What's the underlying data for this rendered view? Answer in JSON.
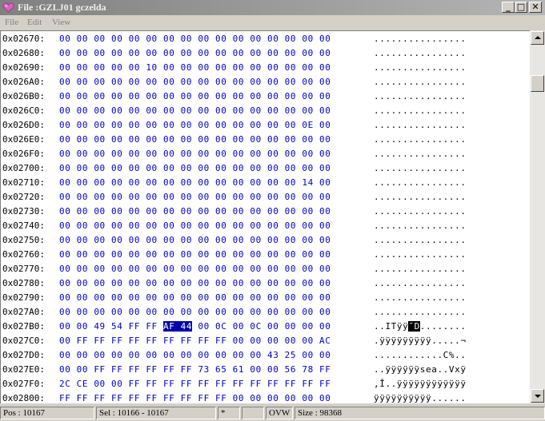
{
  "window": {
    "title": "File :GZLJ01 gczelda",
    "buttons": {
      "minimize": "_",
      "maximize": "□",
      "close": "✕"
    }
  },
  "menu": [
    {
      "label": "File",
      "accel": "F"
    },
    {
      "label": "Edit",
      "accel": "E"
    },
    {
      "label": "View",
      "accel": "V"
    }
  ],
  "rows": [
    {
      "addr": "0x02670:",
      "bytes": "00 00 00 00 00 00 00 00 00 00 00 00 00 00 00 00",
      "ascii": "................"
    },
    {
      "addr": "0x02680:",
      "bytes": "00 00 00 00 00 00 00 00 00 00 00 00 00 00 00 00",
      "ascii": "................"
    },
    {
      "addr": "0x02690:",
      "bytes": "00 00 00 00 00 10 00 00 00 00 00 00 00 00 00 00",
      "ascii": "................"
    },
    {
      "addr": "0x026A0:",
      "bytes": "00 00 00 00 00 00 00 00 00 00 00 00 00 00 00 00",
      "ascii": "................"
    },
    {
      "addr": "0x026B0:",
      "bytes": "00 00 00 00 00 00 00 00 00 00 00 00 00 00 00 00",
      "ascii": "................"
    },
    {
      "addr": "0x026C0:",
      "bytes": "00 00 00 00 00 00 00 00 00 00 00 00 00 00 00 00",
      "ascii": "................"
    },
    {
      "addr": "0x026D0:",
      "bytes": "00 00 00 00 00 00 00 00 00 00 00 00 00 00 0E 00",
      "ascii": "................"
    },
    {
      "addr": "0x026E0:",
      "bytes": "00 00 00 00 00 00 00 00 00 00 00 00 00 00 00 00",
      "ascii": "................"
    },
    {
      "addr": "0x026F0:",
      "bytes": "00 00 00 00 00 00 00 00 00 00 00 00 00 00 00 00",
      "ascii": "................"
    },
    {
      "addr": "0x02700:",
      "bytes": "00 00 00 00 00 00 00 00 00 00 00 00 00 00 00 00",
      "ascii": "................"
    },
    {
      "addr": "0x02710:",
      "bytes": "00 00 00 00 00 00 00 00 00 00 00 00 00 00 14 00",
      "ascii": "................"
    },
    {
      "addr": "0x02720:",
      "bytes": "00 00 00 00 00 00 00 00 00 00 00 00 00 00 00 00",
      "ascii": "................"
    },
    {
      "addr": "0x02730:",
      "bytes": "00 00 00 00 00 00 00 00 00 00 00 00 00 00 00 00",
      "ascii": "................"
    },
    {
      "addr": "0x02740:",
      "bytes": "00 00 00 00 00 00 00 00 00 00 00 00 00 00 00 00",
      "ascii": "................"
    },
    {
      "addr": "0x02750:",
      "bytes": "00 00 00 00 00 00 00 00 00 00 00 00 00 00 00 00",
      "ascii": "................"
    },
    {
      "addr": "0x02760:",
      "bytes": "00 00 00 00 00 00 00 00 00 00 00 00 00 00 00 00",
      "ascii": "................"
    },
    {
      "addr": "0x02770:",
      "bytes": "00 00 00 00 00 00 00 00 00 00 00 00 00 00 00 00",
      "ascii": "................"
    },
    {
      "addr": "0x02780:",
      "bytes": "00 00 00 00 00 00 00 00 00 00 00 00 00 00 00 00",
      "ascii": "................"
    },
    {
      "addr": "0x02790:",
      "bytes": "00 00 00 00 00 00 00 00 00 00 00 00 00 00 00 00",
      "ascii": "................"
    },
    {
      "addr": "0x027A0:",
      "bytes": "00 00 00 00 00 00 00 00 00 00 00 00 00 00 00 00",
      "ascii": "................"
    },
    {
      "addr": "0x027B0:",
      "bytes_pre": "00 00 49 54 FF FF ",
      "bytes_sel": "AF 44",
      "bytes_post": " 00 0C 00 0C 00 00 00 00",
      "ascii_pre": "..ITÿÿ",
      "ascii_sel": "¯D",
      "ascii_post": "........"
    },
    {
      "addr": "0x027C0:",
      "bytes": "00 FF FF FF FF FF FF FF FF FF 00 00 00 00 00 AC",
      "ascii": ".ÿÿÿÿÿÿÿÿÿ.....¬"
    },
    {
      "addr": "0x027D0:",
      "bytes": "00 00 00 00 00 00 00 00 00 00 00 00 43 25 00 00",
      "ascii": "............C%.."
    },
    {
      "addr": "0x027E0:",
      "bytes": "00 00 FF FF FF FF FF FF 73 65 61 00 00 56 78 FF",
      "ascii": "..ÿÿÿÿÿÿsea..Vxÿ"
    },
    {
      "addr": "0x027F0:",
      "bytes": "2C CE 00 00 FF FF FF FF FF FF FF FF FF FF FF FF",
      "ascii": ",Î..ÿÿÿÿÿÿÿÿÿÿÿÿ"
    },
    {
      "addr": "0x02800:",
      "bytes": "FF FF FF FF FF FF FF FF FF FF 00 00 00 00 00 00",
      "ascii": "ÿÿÿÿÿÿÿÿÿÿ......"
    }
  ],
  "status": {
    "pos": "Pos : 10167",
    "sel": "Sel : 10166 - 10167",
    "modified": "*",
    "empty": "",
    "mode": "OVW",
    "size": "Size : 98368"
  },
  "colors": {
    "byte_text": "#0000cc",
    "selection_bg": "#0000aa",
    "titlebar_inactive": "#808080"
  }
}
